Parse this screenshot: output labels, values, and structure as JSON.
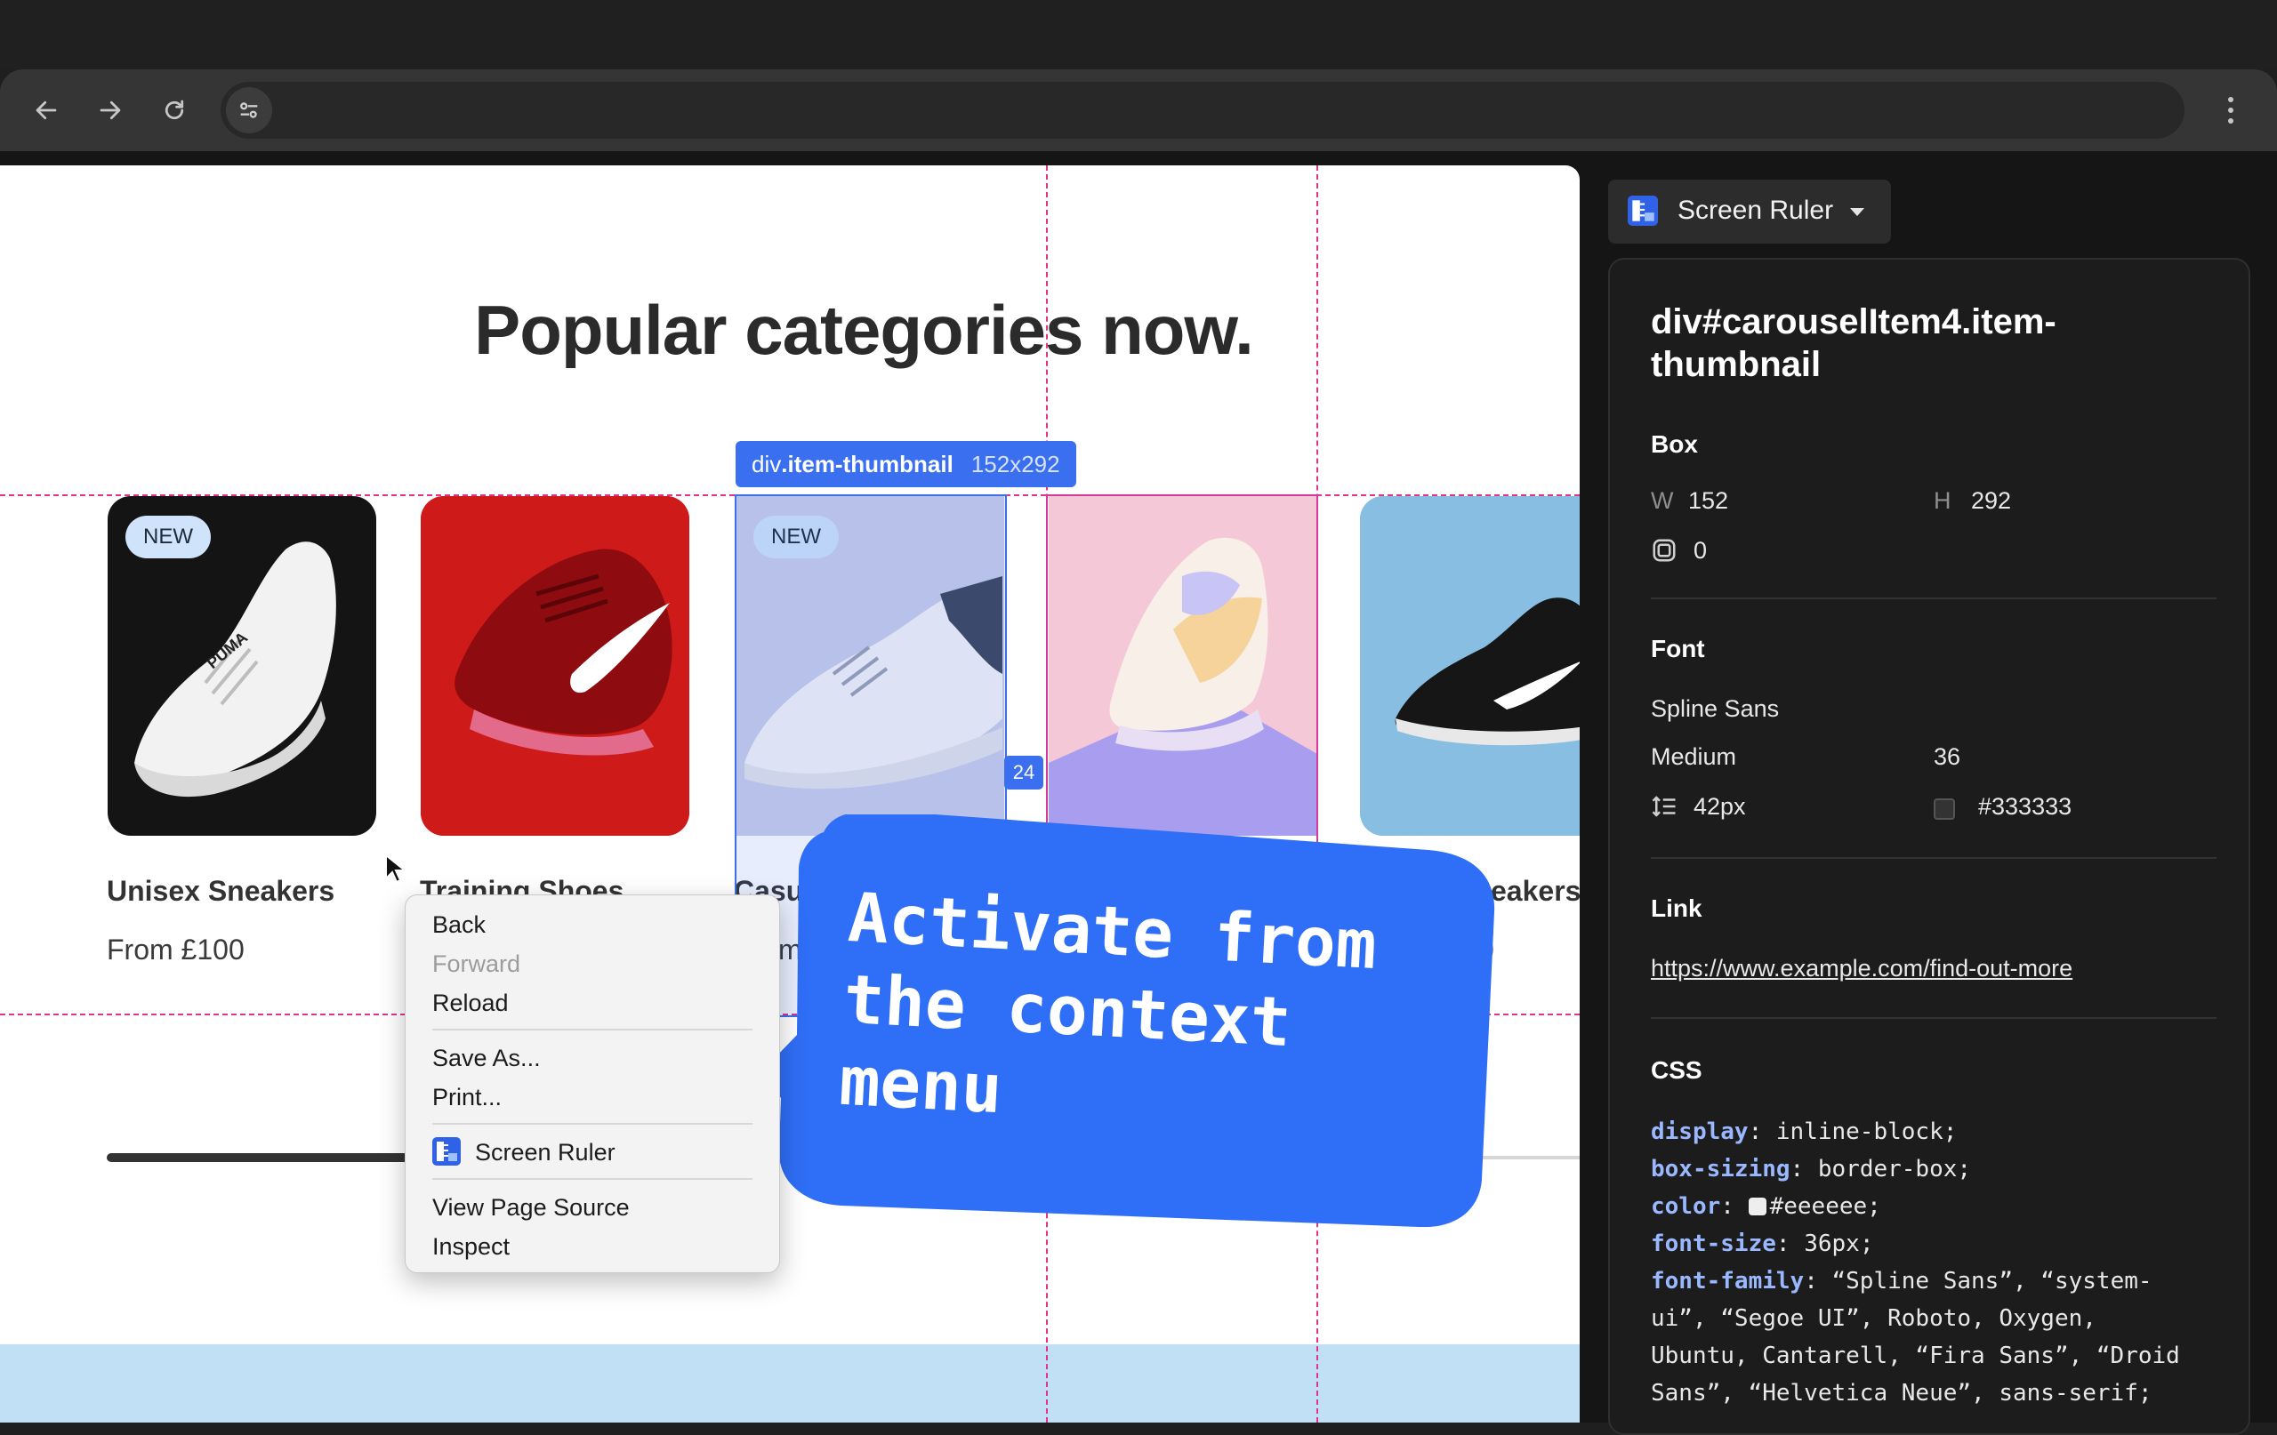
{
  "browser": {
    "address": ""
  },
  "page": {
    "title": "Popular categories now.",
    "cards": [
      {
        "badge": "NEW",
        "name": "Unisex Sneakers",
        "price": "From £100"
      },
      {
        "badge": "",
        "name": "Training Shoes",
        "price": ""
      },
      {
        "badge": "NEW",
        "name": "Casu",
        "price": "m"
      },
      {
        "badge": "",
        "name": "",
        "price": ""
      },
      {
        "badge": "",
        "name": "eakers",
        "price": "0"
      }
    ]
  },
  "overlay": {
    "tag_element": "div",
    "tag_class": ".item-thumbnail",
    "tag_size": "152x292",
    "gap_value": "24"
  },
  "context_menu": {
    "back": "Back",
    "forward": "Forward",
    "reload": "Reload",
    "save_as": "Save As...",
    "print": "Print...",
    "screen_ruler": "Screen Ruler",
    "view_source": "View Page Source",
    "inspect": "Inspect"
  },
  "callout": {
    "text": "Activate from the context menu",
    "color": "#2f6ef6"
  },
  "extension": {
    "button_label": "Screen Ruler",
    "selector": "div#carouselItem4.item-thumbnail",
    "box": {
      "heading": "Box",
      "w_label": "W",
      "w_value": "152",
      "h_label": "H",
      "h_value": "292",
      "radius_value": "0"
    },
    "font": {
      "heading": "Font",
      "family": "Spline Sans",
      "weight": "Medium",
      "size": "36",
      "line_height": "42px",
      "color": "#333333"
    },
    "link": {
      "heading": "Link",
      "url": "https://www.example.com/find-out-more"
    },
    "css": {
      "heading": "CSS",
      "lines": [
        {
          "prop": "display",
          "value": " inline-block;"
        },
        {
          "prop": "box-sizing",
          "value": " border-box;"
        },
        {
          "prop": "color",
          "value": "#eeeeee;"
        },
        {
          "prop": "font-size",
          "value": " 36px;"
        },
        {
          "prop": "font-family",
          "value": " “Spline Sans”, “system-"
        },
        {
          "prop": "",
          "value": "ui”, “Segoe UI”, Roboto, Oxygen,"
        },
        {
          "prop": "",
          "value": "Ubuntu, Cantarell, “Fira Sans”, “Droid"
        },
        {
          "prop": "",
          "value": "Sans”, “Helvetica Neue”, sans-serif;"
        }
      ]
    }
  },
  "colors": {
    "accent": "#3a6ff0",
    "guide": "#e0338e",
    "swatch_color": "#eeeeee",
    "swatch_font": "#333333"
  }
}
